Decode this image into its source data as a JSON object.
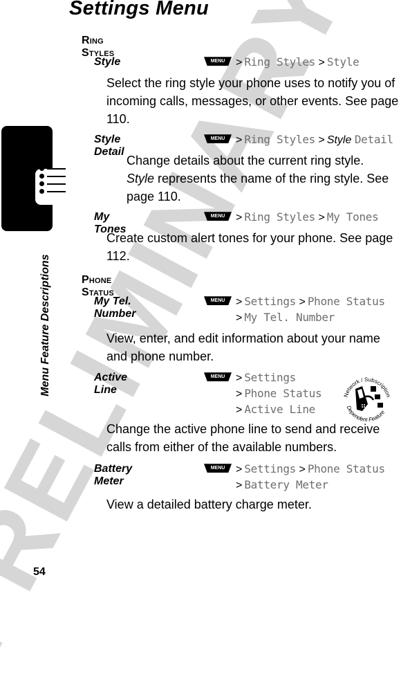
{
  "page": {
    "title": "Settings Menu",
    "side_label": "Menu Feature Descriptions",
    "page_number": "54",
    "watermark": "PRELIMINARY"
  },
  "menu_key_label": "MENU",
  "sections": [
    {
      "heading": "Ring Styles",
      "items": [
        {
          "label": "Style",
          "path": [
            "Ring Styles",
            "Style"
          ],
          "description": "Select the ring style your phone uses to notify you of incoming calls, messages, or other events. See page 110."
        },
        {
          "label": "Style Detail",
          "path": [
            "Ring Styles",
            "Style Detail"
          ],
          "path_italic_prefix": "Style",
          "path_suffix": "Detail",
          "description_italic": "Style",
          "description_line1": "Change details about the current ring style.",
          "description": "represents the name of the ring style. See page 110."
        },
        {
          "label": "My Tones",
          "path": [
            "Ring Styles",
            "My Tones"
          ],
          "description": "Create custom alert tones for your phone. See page 112."
        }
      ]
    },
    {
      "heading": "Phone Status",
      "items": [
        {
          "label": "My Tel. Number",
          "path": [
            "Settings",
            "Phone Status",
            "My Tel. Number"
          ],
          "description": "View, enter, and edit information about your name and phone number."
        },
        {
          "label": "Active Line",
          "path": [
            "Settings",
            "Phone Status",
            "Active Line"
          ],
          "description": "Change the active phone line to send and receive calls from either of the available numbers.",
          "badge": {
            "icon": "network-subscription-dependent-feature-icon",
            "text_top": "Network / Subscription",
            "text_bottom": "Dependent Feature"
          }
        },
        {
          "label": "Battery Meter",
          "path": [
            "Settings",
            "Phone Status",
            "Battery Meter"
          ],
          "description": "View a detailed battery charge meter."
        }
      ]
    }
  ],
  "colors": {
    "text": "#000000",
    "menu_path": "#6e6e6e",
    "watermark": "#d6d6d6"
  }
}
